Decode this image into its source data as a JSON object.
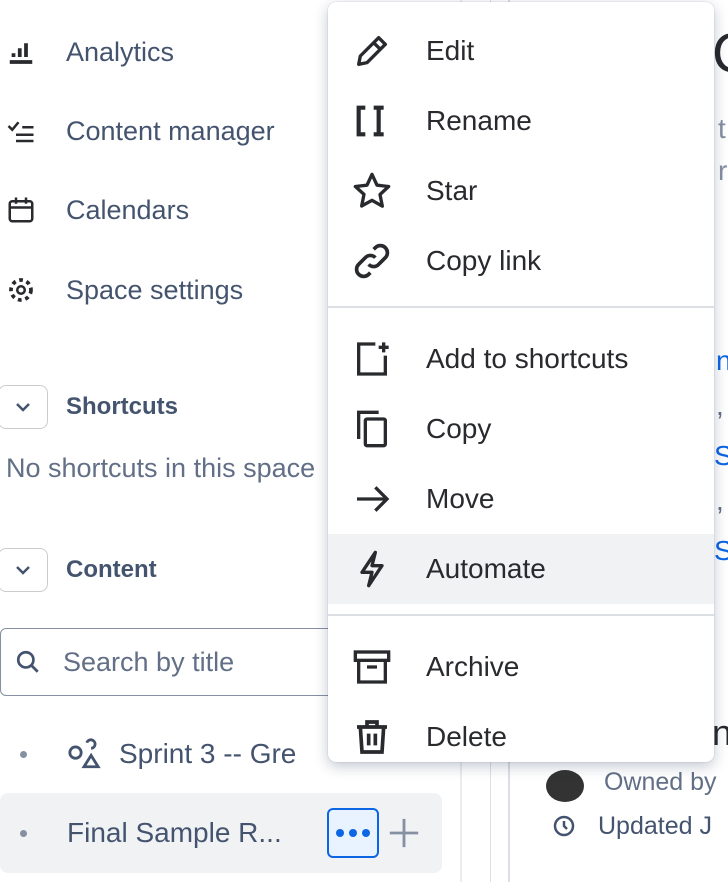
{
  "sidebar": {
    "nav": [
      {
        "label": "Analytics",
        "icon": "bar-chart-icon"
      },
      {
        "label": "Content manager",
        "icon": "checklist-icon"
      },
      {
        "label": "Calendars",
        "icon": "calendar-icon"
      },
      {
        "label": "Space settings",
        "icon": "gear-icon"
      }
    ],
    "shortcuts": {
      "title": "Shortcuts",
      "empty": "No shortcuts in this space"
    },
    "content": {
      "title": "Content",
      "search_placeholder": "Search by title"
    },
    "tree": [
      {
        "label": "Sprint 3 -- Gre",
        "icon": "whiteboard-icon"
      },
      {
        "label": "Final Sample R...",
        "selected": true
      }
    ]
  },
  "main": {
    "fragment_title": "C",
    "frag1": "t",
    "frag2": "r",
    "link1": "n",
    "meta1": ",",
    "link2": "S",
    "meta2": ",",
    "link3": "S",
    "frag_heading": "n",
    "owned_by": "Owned by",
    "updated": "Updated J"
  },
  "menu": {
    "groups": [
      [
        {
          "label": "Edit",
          "icon": "pencil-icon"
        },
        {
          "label": "Rename",
          "icon": "rename-icon"
        },
        {
          "label": "Star",
          "icon": "star-icon"
        },
        {
          "label": "Copy link",
          "icon": "link-icon"
        }
      ],
      [
        {
          "label": "Add to shortcuts",
          "icon": "add-shortcut-icon"
        },
        {
          "label": "Copy",
          "icon": "copy-icon"
        },
        {
          "label": "Move",
          "icon": "arrow-right-icon"
        },
        {
          "label": "Automate",
          "icon": "lightning-icon",
          "highlighted": true
        }
      ],
      [
        {
          "label": "Archive",
          "icon": "archive-icon"
        },
        {
          "label": "Delete",
          "icon": "trash-icon"
        }
      ]
    ]
  },
  "colors": {
    "accent": "#0c66e4",
    "highlight": "#f1f2f4",
    "text": "#292a2e"
  }
}
